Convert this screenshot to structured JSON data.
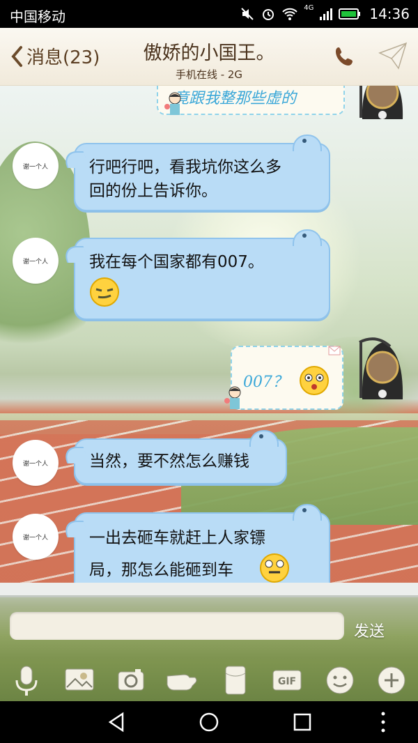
{
  "status_bar": {
    "carrier": "中国移动",
    "network": "4G",
    "time": "14:36"
  },
  "header": {
    "back_label": "消息(23)",
    "title": "傲娇的小国王。",
    "subtitle": "手机在线 - 2G"
  },
  "avatars": {
    "peer_text": "谢一个人"
  },
  "messages": [
    {
      "from": "me",
      "text": "竟跟我整那些虚的"
    },
    {
      "from": "peer",
      "lines": [
        "行吧行吧，看我坑你这么多",
        "回的份上告诉你。"
      ]
    },
    {
      "from": "peer",
      "lines": [
        "我在每个国家都有007。"
      ],
      "emoji": "smug-face"
    },
    {
      "from": "me",
      "text": "007？",
      "emoji": "shocked-face"
    },
    {
      "from": "peer",
      "lines": [
        "当然，要不然怎么赚钱"
      ]
    },
    {
      "from": "peer",
      "lines": [
        "一出去砸车就赶上人家镖",
        "局，那怎么能砸到车"
      ],
      "emoji": "dizzy-face"
    }
  ],
  "input": {
    "placeholder": "",
    "send_label": "发送"
  },
  "toolbar": [
    "mic",
    "picture",
    "camera",
    "hand",
    "red-packet",
    "gif",
    "emoji",
    "plus"
  ]
}
